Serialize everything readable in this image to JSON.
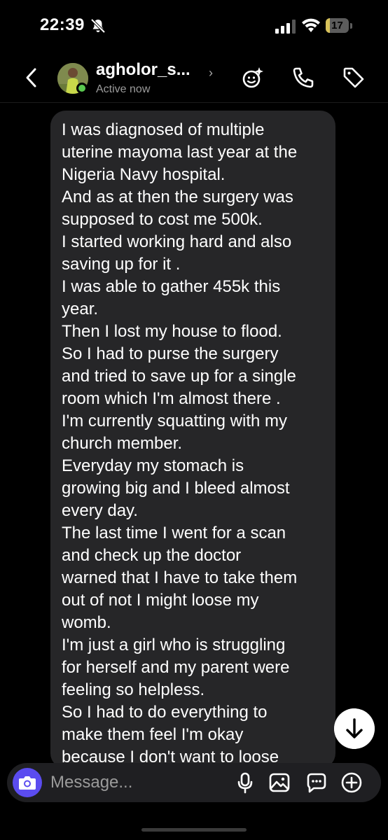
{
  "status_bar": {
    "time": "22:39",
    "battery_level": "17",
    "battery_fraction": 0.17,
    "accent_battery": "#d8c25a"
  },
  "header": {
    "username": "agholor_s...",
    "status": "Active now",
    "icons": [
      "chevron-left-icon",
      "effects-sparkle-icon",
      "phone-icon",
      "tag-icon"
    ]
  },
  "message": {
    "lines": [
      "I was diagnosed of multiple",
      "uterine mayoma last year at the",
      "Nigeria Navy hospital.",
      "And as at then the surgery was",
      "supposed to cost me 500k.",
      "I started working hard and also",
      "saving up for it .",
      "I was able to gather 455k this",
      "year.",
      "Then I lost my house to flood.",
      "So I had to purse the surgery",
      "and tried to save up for a single",
      "room  which I'm almost there .",
      "I'm currently squatting with my",
      "church member.",
      "Everyday my stomach is",
      "growing big and I bleed almost",
      "every day.",
      "The last time I went for a scan",
      "and check up the doctor",
      "warned that I have to take them",
      "out of not I might loose my",
      "womb.",
      "I'm just a girl who is struggling",
      "for herself and my parent were",
      "feeling so helpless.",
      "So I had to do everything to",
      "make them feel I'm okay",
      "because I don't want to loose"
    ]
  },
  "composer": {
    "placeholder": "Message...",
    "icons": [
      "camera-icon",
      "microphone-icon",
      "gallery-icon",
      "sticker-icon",
      "plus-circle-icon"
    ],
    "camera_color": "#5b4cf0"
  }
}
